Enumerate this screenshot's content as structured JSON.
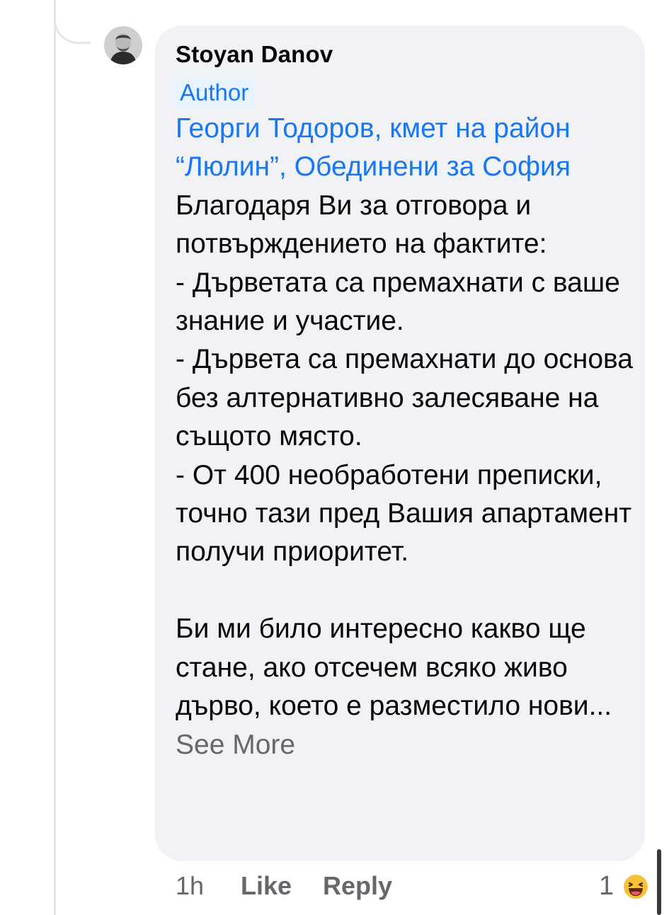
{
  "comment": {
    "author_name": "Stoyan Danov",
    "author_badge": "Author",
    "mention": "Георги Тодоров, кмет на район “Люлин”, Обединени за София",
    "text": " Благодаря Ви за отговора и потвърждението на фактите:\n- Дърветата са премахнати с ваше знание и участие.\n- Дървета са премахнати до основа без алтернативно залесяване на същото място.\n- От 400 необработени преписки, точно тази пред Вашия апартамент получи приоритет.\n\nБи ми било интересно какво ще стане, ако отсечем всяко живо дърво, което е разместило нови",
    "truncation": "... ",
    "see_more_label": "See More"
  },
  "actions": {
    "time": "1h",
    "like_label": "Like",
    "reply_label": "Reply"
  },
  "reactions": {
    "count": "1",
    "icon": "haha-emoji-icon"
  },
  "colors": {
    "link": "#1877f2",
    "bubble": "#f0f2f5",
    "secondary_text": "#65676b",
    "primary_text": "#050505",
    "badge_bg": "#e7f3ff"
  }
}
